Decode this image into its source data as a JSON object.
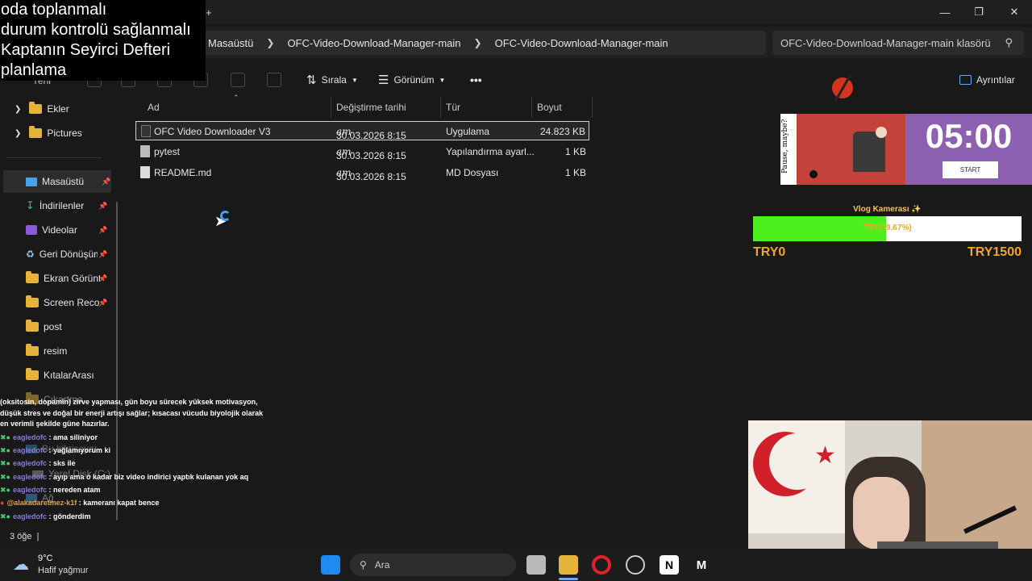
{
  "overlay_lines": [
    "oda toplanmalı",
    "durum kontrolü sağlanmalı",
    "Kaptanın Seyirci Defteri",
    "planlama"
  ],
  "address": {
    "crumbs": [
      "Masaüstü",
      "OFC-Video-Download-Manager-main",
      "OFC-Video-Download-Manager-main"
    ],
    "search_placeholder": "OFC-Video-Download-Manager-main klasörü"
  },
  "commandbar": {
    "new_label": "Yeni",
    "sort_label": "Sırala",
    "view_label": "Görünüm",
    "more_label": "•••",
    "details_label": "Ayrıntılar"
  },
  "sidebar": {
    "items": [
      {
        "label": "Ekler",
        "type": "folder"
      },
      {
        "label": "Pictures",
        "type": "folder"
      },
      {
        "label": "Masaüstü",
        "type": "desktop"
      },
      {
        "label": "İndirilenler",
        "type": "download"
      },
      {
        "label": "Videolar",
        "type": "video"
      },
      {
        "label": "Geri Dönüşüm",
        "type": "recycle"
      },
      {
        "label": "Ekran Görüntü",
        "type": "folder"
      },
      {
        "label": "Screen Record",
        "type": "folder"
      },
      {
        "label": "post",
        "type": "folder"
      },
      {
        "label": "resim",
        "type": "folder"
      },
      {
        "label": "KıtalarArası",
        "type": "folder"
      },
      {
        "label": "Çıkartma",
        "type": "folder"
      },
      {
        "label": "Bu bilgisayar",
        "type": "pc"
      },
      {
        "label": "Yerel Disk (C:)",
        "type": "disk"
      },
      {
        "label": "Ağ",
        "type": "network"
      }
    ]
  },
  "columns": {
    "name": "Ad",
    "modified": "Değiştirme tarihi",
    "type": "Tür",
    "size": "Boyut"
  },
  "files": [
    {
      "name": "OFC Video Downloader V3",
      "modified": "30.03.2026 8:15",
      "ampm": "am",
      "type": "Uygulama",
      "size": "24.823 KB"
    },
    {
      "name": "pytest",
      "modified": "30.03.2026 8:15",
      "ampm": "am",
      "type": "Yapılandırma ayarl...",
      "size": "1 KB"
    },
    {
      "name": "README.md",
      "modified": "30.03.2026 8:15",
      "ampm": "am",
      "type": "MD Dosyası",
      "size": "1 KB"
    }
  ],
  "status": {
    "item_count": "3 öğe"
  },
  "chat": {
    "intro": "(oksitosin, dopamin) zirve yapması, gün boyu sürecek yüksek motivasyon, düşük stres ve doğal bir enerji artışı sağlar; kısacası vücudu biyolojik olarak en verimli şekilde güne hazırlar.",
    "messages": [
      {
        "user": "eagledofc",
        "text": ": ama siliniyor"
      },
      {
        "user": "eagledofc",
        "text": ": yağlamıyorum ki"
      },
      {
        "user": "eagledofc",
        "text": ": sks ile"
      },
      {
        "user": "eagledofc",
        "text": ": ayıp ama o kadar biz video indirici yaptık kulanan yok aq"
      },
      {
        "user": "eagledofc",
        "text": ": nereden atam"
      },
      {
        "user": "@alakadaretmez-k1f",
        "text": ": kameranı kapat bence"
      },
      {
        "user": "eagledofc",
        "text": ": gönderdim"
      }
    ]
  },
  "pomodoro": {
    "quote": "Pause, maybe?",
    "timer": "05:00",
    "start_label": "START"
  },
  "goal": {
    "title": "Vlog Kamerası ✨",
    "progress": 0.4967,
    "amount_text": "TRY(49.67%)",
    "min_label": "TRY0",
    "max_label": "TRY1500"
  },
  "weather": {
    "temp": "9°C",
    "desc": "Hafif yağmur"
  },
  "taskbar": {
    "search_label": "Ara"
  },
  "colors": {
    "accent": "#4cf01e",
    "goal_text": "#f4a61e",
    "pomodoro": "#8c5fb0",
    "folder": "#e8b33a"
  }
}
